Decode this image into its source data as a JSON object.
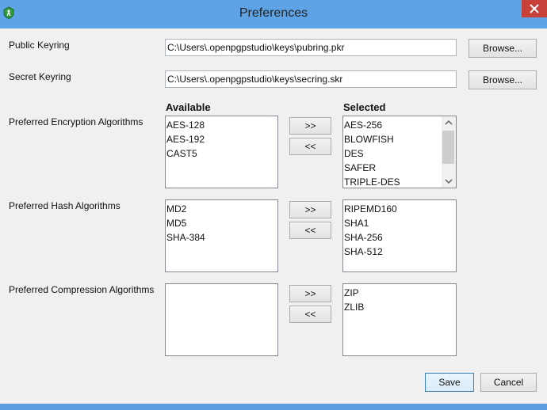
{
  "window": {
    "title": "Preferences",
    "colors": {
      "titlebar": "#5ea3e6",
      "close": "#c7403a",
      "background": "#f0f0f0"
    }
  },
  "public_keyring": {
    "label": "Public Keyring",
    "value": "C:\\Users\\.openpgpstudio\\keys\\pubring.pkr",
    "browse_label": "Browse..."
  },
  "secret_keyring": {
    "label": "Secret Keyring",
    "value": "C:\\Users\\.openpgpstudio\\keys\\secring.skr",
    "browse_label": "Browse..."
  },
  "columns": {
    "available": "Available",
    "selected": "Selected"
  },
  "encryption": {
    "label": "Preferred Encryption Algorithms",
    "available": [
      "AES-128",
      "AES-192",
      "CAST5"
    ],
    "selected": [
      "AES-256",
      "BLOWFISH",
      "DES",
      "SAFER",
      "TRIPLE-DES"
    ]
  },
  "hash": {
    "label": "Preferred Hash Algorithms",
    "available": [
      "MD2",
      "MD5",
      "SHA-384"
    ],
    "selected": [
      "RIPEMD160",
      "SHA1",
      "SHA-256",
      "SHA-512"
    ]
  },
  "compression": {
    "label": "Preferred Compression Algorithms",
    "available": [],
    "selected": [
      "ZIP",
      "ZLIB"
    ]
  },
  "transfer": {
    "add": ">>",
    "remove": "<<"
  },
  "footer": {
    "save_label": "Save",
    "cancel_label": "Cancel"
  }
}
